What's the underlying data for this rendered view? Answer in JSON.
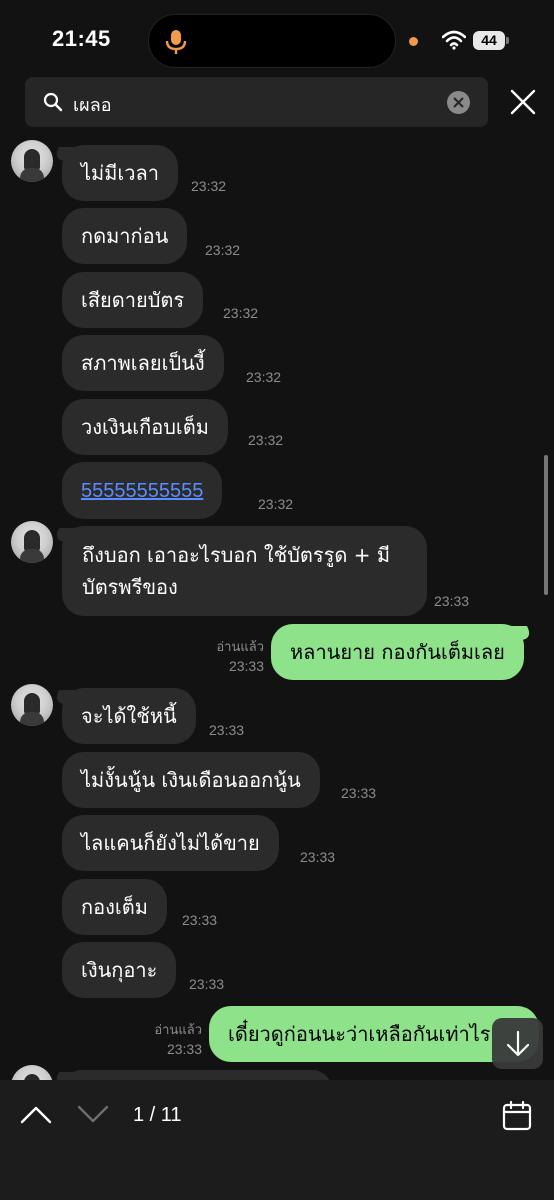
{
  "status_bar": {
    "time": "21:45",
    "battery": "44"
  },
  "search": {
    "query": "เผลอ"
  },
  "messages": [
    {
      "text": "ไม่มีเวลา",
      "time": "23:32"
    },
    {
      "text": "กดมาก่อน",
      "time": "23:32"
    },
    {
      "text": "เสียดายบัตร",
      "time": "23:32"
    },
    {
      "text": "สภาพเลยเป็นงี้",
      "time": "23:32"
    },
    {
      "text": "วงเงินเกือบเต็ม",
      "time": "23:32"
    },
    {
      "text": "55555555555",
      "time": "23:32"
    },
    {
      "text": "ถึงบอก เอาอะไรบอก ใช้บัตรรูด + มีบัตรพรีของ",
      "time": "23:33"
    },
    {
      "text": "หลานยาย กองกันเต็มเลย",
      "time": "23:33",
      "read": "อ่านแล้ว"
    },
    {
      "text": "จะได้ใช้หนี้",
      "time": "23:33"
    },
    {
      "text": "ไม่งั้นนู้น เงินเดือนออกนู้น",
      "time": "23:33"
    },
    {
      "text": "ไลแคนก็ยังไม่ได้ขาย",
      "time": "23:33"
    },
    {
      "text": "กองเต็ม",
      "time": "23:33"
    },
    {
      "text": "เงินกุอาะ",
      "time": "23:33"
    },
    {
      "text": "เดี๋ยวดูก่อนนะว่าเหลือกันเท่าไร",
      "time": "23:33",
      "read": "อ่านแล้ว"
    }
  ],
  "navigator": {
    "counter": "1 / 11"
  },
  "colors": {
    "outgoing": "#8de28a",
    "incoming": "#2b2b2b",
    "link": "#5b8cff"
  },
  "icons": [
    "mic-icon",
    "wifi-icon",
    "search-icon",
    "clear-icon",
    "close-icon",
    "chevron-up-icon",
    "chevron-down-icon",
    "calendar-icon",
    "arrow-down-icon"
  ]
}
